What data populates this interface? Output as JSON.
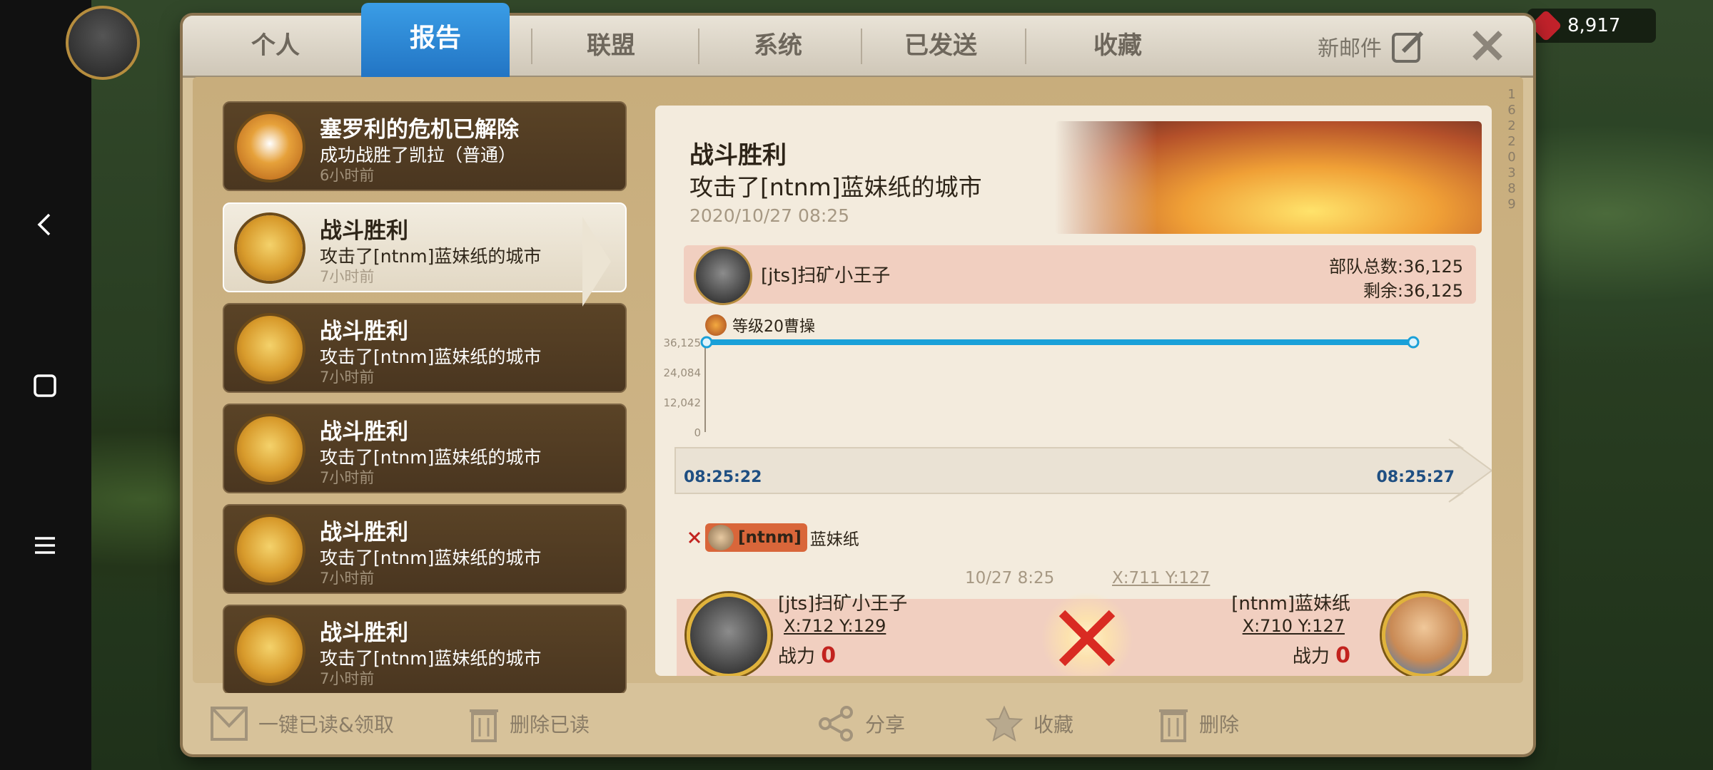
{
  "status": {
    "gems": "8,917"
  },
  "tabs": [
    {
      "label": "个人"
    },
    {
      "label": "报告"
    },
    {
      "label": "联盟"
    },
    {
      "label": "系统"
    },
    {
      "label": "已发送"
    },
    {
      "label": "收藏"
    }
  ],
  "new_mail_label": "新邮件",
  "list": [
    {
      "title": "塞罗利的危机已解除",
      "subtitle": "成功战胜了凯拉（普通）",
      "time": "6小时前"
    },
    {
      "title": "战斗胜利",
      "subtitle": "攻击了[ntnm]蓝妹纸的城市",
      "time": "7小时前"
    },
    {
      "title": "战斗胜利",
      "subtitle": "攻击了[ntnm]蓝妹纸的城市",
      "time": "7小时前"
    },
    {
      "title": "战斗胜利",
      "subtitle": "攻击了[ntnm]蓝妹纸的城市",
      "time": "7小时前"
    },
    {
      "title": "战斗胜利",
      "subtitle": "攻击了[ntnm]蓝妹纸的城市",
      "time": "7小时前"
    },
    {
      "title": "战斗胜利",
      "subtitle": "攻击了[ntnm]蓝妹纸的城市",
      "time": "7小时前"
    }
  ],
  "report": {
    "title": "战斗胜利",
    "subtitle": "攻击了[ntnm]蓝妹纸的城市",
    "datetime": "2020/10/27 08:25",
    "player": {
      "name": "[jts]扫矿小王子",
      "total_troops": "部队总数:36,125",
      "remaining": "剩余:36,125",
      "commander": "等级20曹操"
    },
    "timeline": {
      "start": "08:25:22",
      "end": "08:25:27"
    },
    "enemy_tag": "[ntnm]",
    "enemy_name": "蓝妹纸",
    "battle_time": "10/27 8:25",
    "battle_coord": "X:711 Y:127",
    "left": {
      "name": "[jts]扫矿小王子",
      "coord": "X:712 Y:129",
      "power_label": "战力",
      "power": "0"
    },
    "right": {
      "name": "[ntnm]蓝妹纸",
      "coord": "X:710 Y:127",
      "power_label": "战力",
      "power": "0"
    }
  },
  "chart_data": {
    "type": "line",
    "x": [
      "08:25:22",
      "08:25:27"
    ],
    "yticks": [
      "36,125",
      "24,084",
      "12,042",
      "0"
    ],
    "ylim": [
      0,
      36125
    ],
    "series": [
      {
        "name": "等级20曹操",
        "values": [
          36125,
          36125
        ],
        "color": "#1aa0d8"
      }
    ]
  },
  "footer": {
    "read_all": "一键已读&领取",
    "delete_read": "删除已读",
    "share": "分享",
    "favorite": "收藏",
    "delete": "删除"
  },
  "scroll_digits": [
    "1",
    "6",
    "2",
    "2",
    "0",
    "3",
    "8",
    "9"
  ],
  "colors": {
    "tab_active": "#2a85d2",
    "accent_red": "#c2231e",
    "line": "#1aa0d8"
  }
}
